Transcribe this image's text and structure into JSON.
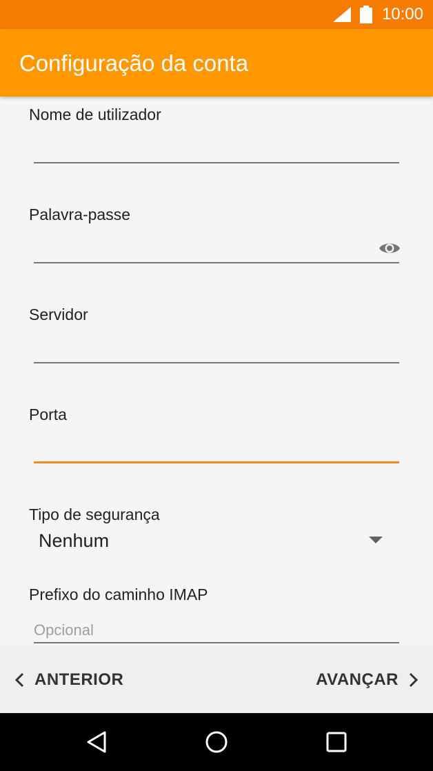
{
  "status_bar": {
    "time": "10:00",
    "icons": [
      "signal-icon",
      "battery-icon"
    ]
  },
  "app_bar": {
    "title": "Configuração da conta"
  },
  "form": {
    "username": {
      "label": "Nome de utilizador",
      "value": ""
    },
    "password": {
      "label": "Palavra-passe",
      "value": "",
      "icon": "eye-icon"
    },
    "server": {
      "label": "Servidor",
      "value": ""
    },
    "port": {
      "label": "Porta",
      "value": "",
      "focused": true
    },
    "security": {
      "label": "Tipo de segurança",
      "value": "Nenhum"
    },
    "imap_prefix": {
      "label": "Prefixo do caminho IMAP",
      "placeholder": "Opcional"
    }
  },
  "nav": {
    "previous_label": "ANTERIOR",
    "next_label": "AVANÇAR"
  },
  "system_nav": {
    "buttons": [
      "back-icon",
      "home-icon",
      "recents-icon"
    ]
  },
  "colors": {
    "status_bar": "#f57c00",
    "app_bar": "#ff9800",
    "focus_accent": "#f08c1e"
  }
}
